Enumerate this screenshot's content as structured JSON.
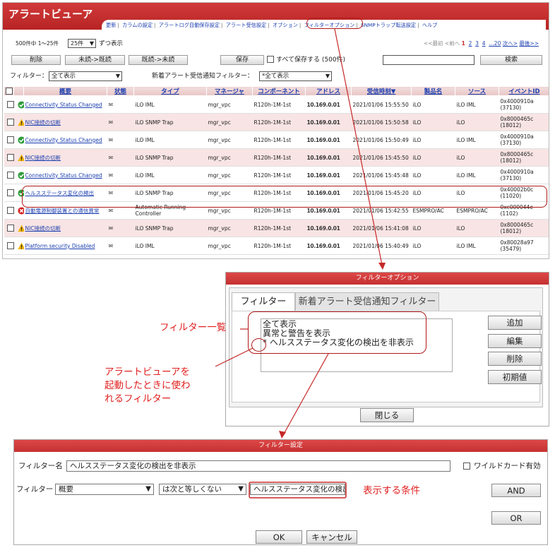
{
  "viewer": {
    "title": "アラートビューア",
    "nav": [
      "更新",
      "カラムの設定",
      "アラートログ自動保存設定",
      "アラート受信設定",
      "オプション",
      "フィルターオプション",
      "SNMPトラップ転送設定",
      "ヘルプ"
    ],
    "count_text": "500件中 1〜25件",
    "per_page": "25件",
    "per_page_suffix": "ずつ表示",
    "pager_prefix": "<<最初 <前へ",
    "pager_current": "1",
    "pager_pages": [
      "2",
      "3",
      "4"
    ],
    "pager_tail": "…20",
    "pager_next": "次へ>",
    "pager_last": "最後>>",
    "delete_label": "削除",
    "unread_to_read_label": "未読->既読",
    "read_to_unread_label": "既読->未読",
    "save_label": "保存",
    "save_all_label": "すべて保存する (500件)",
    "search_value": "",
    "search_label": "検索",
    "filter_label": "フィルター：",
    "filter_value": "全て表示",
    "new_alert_filter_label": "新着アラート受信通知フィルター：",
    "new_alert_filter_value": "*全て表示"
  },
  "table": {
    "headers": [
      "概要",
      "状態",
      "タイプ",
      "マネージャ",
      "コンポーネント",
      "アドレス",
      "受信時刻▼",
      "製品名",
      "ソース",
      "イベントID"
    ],
    "rows": [
      {
        "summary": "Connectivity Status Changed",
        "severity": "ok",
        "type": "iLO IML",
        "manager": "mgr_vpc",
        "component": "R120h-1M-1st",
        "address": "10.169.0.01",
        "time": "2021/01/06 15:55:50",
        "product": "iLO",
        "source": "iLO IML",
        "event_id": "0x4000910a (37130)",
        "pink": false
      },
      {
        "summary": "NIC接続の切断",
        "severity": "warning",
        "type": "iLO SNMP Trap",
        "manager": "mgr_vpc",
        "component": "R120h-1M-1st",
        "address": "10.169.0.01",
        "time": "2021/01/06 15:50:58",
        "product": "iLO",
        "source": "iLO",
        "event_id": "0x8000465c (18012)",
        "pink": true
      },
      {
        "summary": "Connectivity Status Changed",
        "severity": "ok",
        "type": "iLO IML",
        "manager": "mgr_vpc",
        "component": "R120h-1M-1st",
        "address": "10.169.0.01",
        "time": "2021/01/06 15:50:49",
        "product": "iLO",
        "source": "iLO IML",
        "event_id": "0x4000910a (37130)",
        "pink": false
      },
      {
        "summary": "NIC接続の切断",
        "severity": "warning",
        "type": "iLO SNMP Trap",
        "manager": "mgr_vpc",
        "component": "R120h-1M-1st",
        "address": "10.169.0.01",
        "time": "2021/01/06 15:45:50",
        "product": "iLO",
        "source": "iLO",
        "event_id": "0x8000465c (18012)",
        "pink": true
      },
      {
        "summary": "Connectivity Status Changed",
        "severity": "ok",
        "type": "iLO IML",
        "manager": "mgr_vpc",
        "component": "R120h-1M-1st",
        "address": "10.169.0.01",
        "time": "2021/01/06 15:45:48",
        "product": "iLO",
        "source": "iLO IML",
        "event_id": "0x4000910a (37130)",
        "pink": false
      },
      {
        "summary": "ヘルスステータス変化の検出",
        "severity": "ok",
        "type": "iLO SNMP Trap",
        "manager": "mgr_vpc",
        "component": "R120h-1M-1st",
        "address": "10.169.0.01",
        "time": "2021/01/06 15:45:20",
        "product": "iLO",
        "source": "iLO",
        "event_id": "0x40002b0c (11020)",
        "pink": false
      },
      {
        "summary": "自動電源制御装置との通信異常",
        "severity": "error",
        "type": "Automatic Running Controller",
        "manager": "mgr_vpc",
        "component": "R120h-1M-1st",
        "address": "10.169.0.01",
        "time": "2021/01/06 15:42:55",
        "product": "ESMPRO/AC",
        "source": "ESMPRO/AC",
        "event_id": "0xc000044e (1102)",
        "pink": false
      },
      {
        "summary": "NIC接続の切断",
        "severity": "warning",
        "type": "iLO SNMP Trap",
        "manager": "mgr_vpc",
        "component": "R120h-1M-1st",
        "address": "10.169.0.01",
        "time": "2021/01/06 15:41:08",
        "product": "iLO",
        "source": "iLO",
        "event_id": "0x8000465c (18012)",
        "pink": true
      },
      {
        "summary": "Platform security Disabled",
        "severity": "warning",
        "type": "iLO IML",
        "manager": "mgr_vpc",
        "component": "R120h-1M-1st",
        "address": "10.169.0.01",
        "time": "2021/01/06 15:40:49",
        "product": "iLO",
        "source": "iLO IML",
        "event_id": "0x80028a97 (35479)",
        "pink": false
      }
    ]
  },
  "filter_options_dialog": {
    "title": "フィルターオプション",
    "tab_filter": "フィルター",
    "tab_new_alert": "新着アラート受信通知フィルター",
    "filters": [
      "全て表示",
      "異常と警告を表示",
      "* ヘルスステータス変化の検出を非表示"
    ],
    "add_label": "追加",
    "edit_label": "編集",
    "delete_label": "削除",
    "default_label": "初期値",
    "close_label": "閉じる"
  },
  "filter_settings_dialog": {
    "title": "フィルター設定",
    "name_label": "フィルター名",
    "name_value": "ヘルスステータス変化の検出を非表示",
    "wildcard_label": "ワイルドカード有効",
    "filter_label": "フィルター",
    "field_value": "概要",
    "operator_value": "は次と等しくない",
    "condition_value": "ヘルスステータス変化の検出",
    "and_label": "AND",
    "or_label": "OR",
    "ok_label": "OK",
    "cancel_label": "キャンセル"
  },
  "annotations": {
    "filter_list": "フィルター一覧",
    "startup_filter": "アラートビューアを\n起動したときに使わ\nれるフィルター",
    "display_condition": "表示する条件"
  },
  "colors": {
    "accent_red": "#c62828",
    "link_blue": "#1c3fb0",
    "annotation_red": "#e02020"
  }
}
